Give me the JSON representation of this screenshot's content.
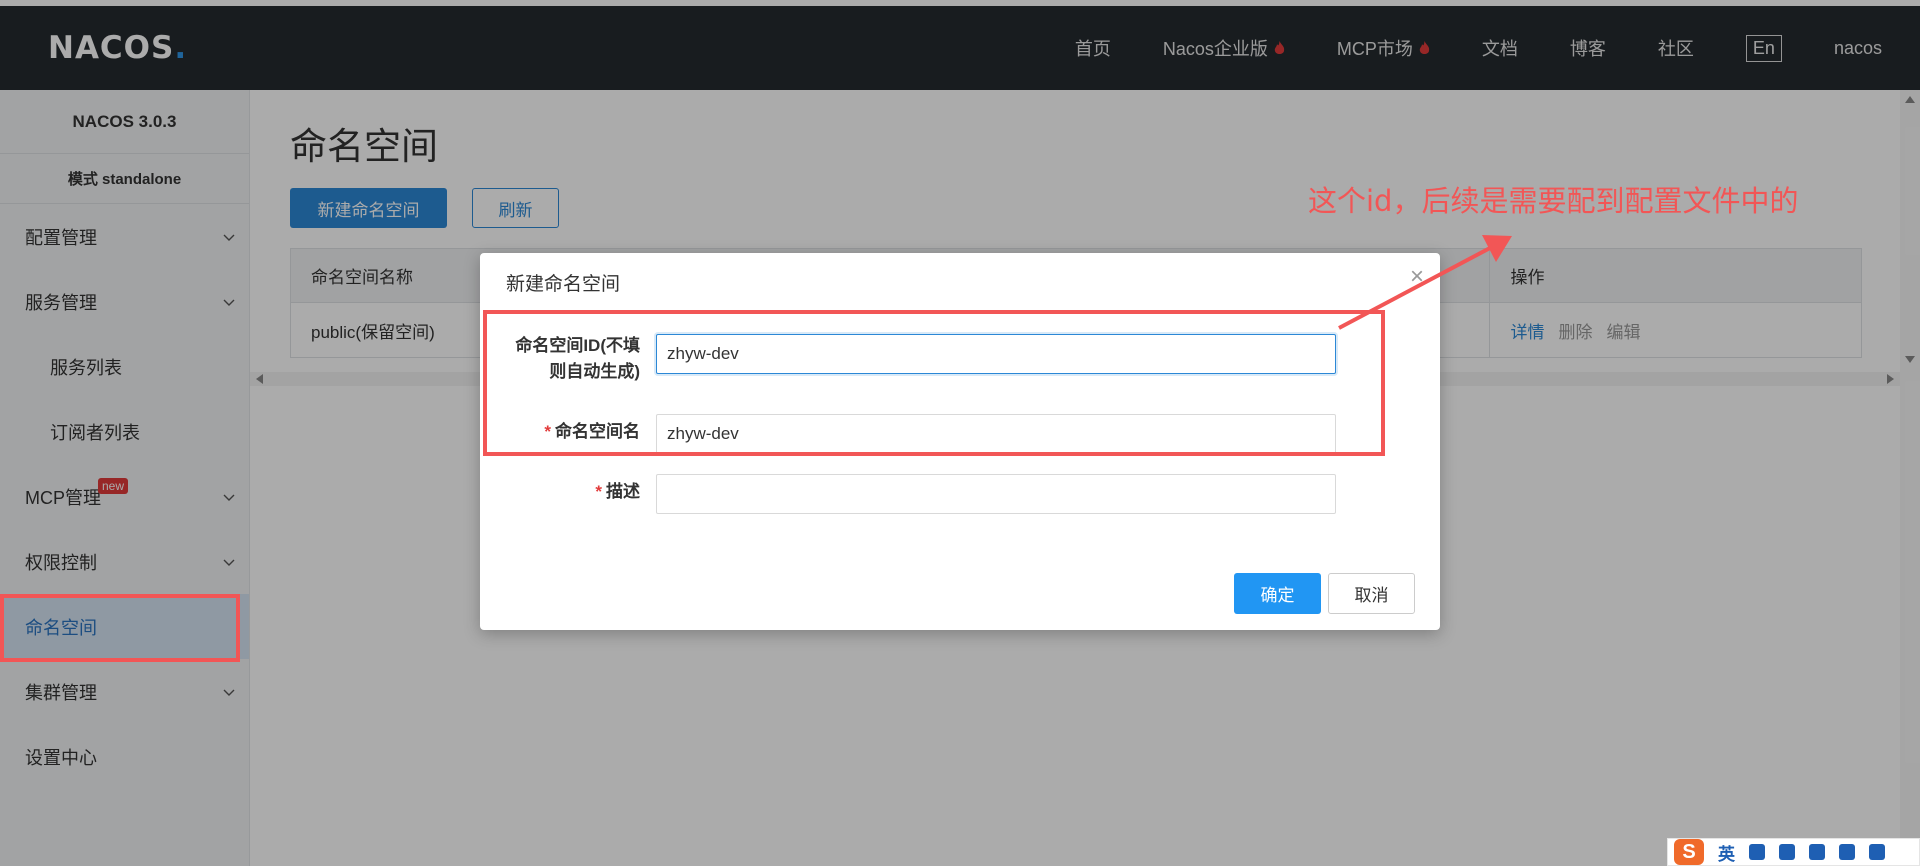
{
  "header": {
    "logo_main": "NACOS",
    "logo_dot": ".",
    "nav": [
      {
        "label": "首页",
        "hot": false
      },
      {
        "label": "Nacos企业版",
        "hot": true
      },
      {
        "label": "MCP市场",
        "hot": true
      },
      {
        "label": "文档",
        "hot": false
      },
      {
        "label": "博客",
        "hot": false
      },
      {
        "label": "社区",
        "hot": false
      }
    ],
    "lang": "En",
    "user": "nacos"
  },
  "sidebar": {
    "version": "NACOS 3.0.3",
    "mode": "模式 standalone",
    "items": [
      {
        "label": "配置管理"
      },
      {
        "label": "服务管理"
      },
      {
        "label": "服务列表"
      },
      {
        "label": "订阅者列表"
      },
      {
        "label": "MCP管理",
        "badge": "new"
      },
      {
        "label": "权限控制"
      },
      {
        "label": "命名空间"
      },
      {
        "label": "集群管理"
      },
      {
        "label": "设置中心"
      }
    ]
  },
  "main": {
    "title": "命名空间",
    "create_button": "新建命名空间",
    "refresh_button": "刷新",
    "table": {
      "headers": [
        "命名空间名称",
        "操作"
      ],
      "rows": [
        {
          "name": "public(保留空间)",
          "ops": [
            "详情",
            "删除",
            "编辑"
          ]
        }
      ]
    }
  },
  "dialog": {
    "title": "新建命名空间",
    "close": "×",
    "fields": {
      "id_label_line1": "命名空间ID(不填",
      "id_label_line2": "则自动生成)",
      "id_value": "zhyw-dev",
      "name_label": "命名空间名",
      "name_value": "zhyw-dev",
      "desc_label": "描述",
      "desc_value": "",
      "required_mark": "*"
    },
    "ok_button": "确定",
    "cancel_button": "取消"
  },
  "annotation": {
    "text": "这个id，后续是需要配到配置文件中的",
    "color": "#f25656"
  },
  "ime": {
    "logo": "S",
    "mode": "英"
  },
  "colors": {
    "topbar": "#252a2f",
    "primary": "#2c88d6",
    "annotation": "#f25656"
  }
}
